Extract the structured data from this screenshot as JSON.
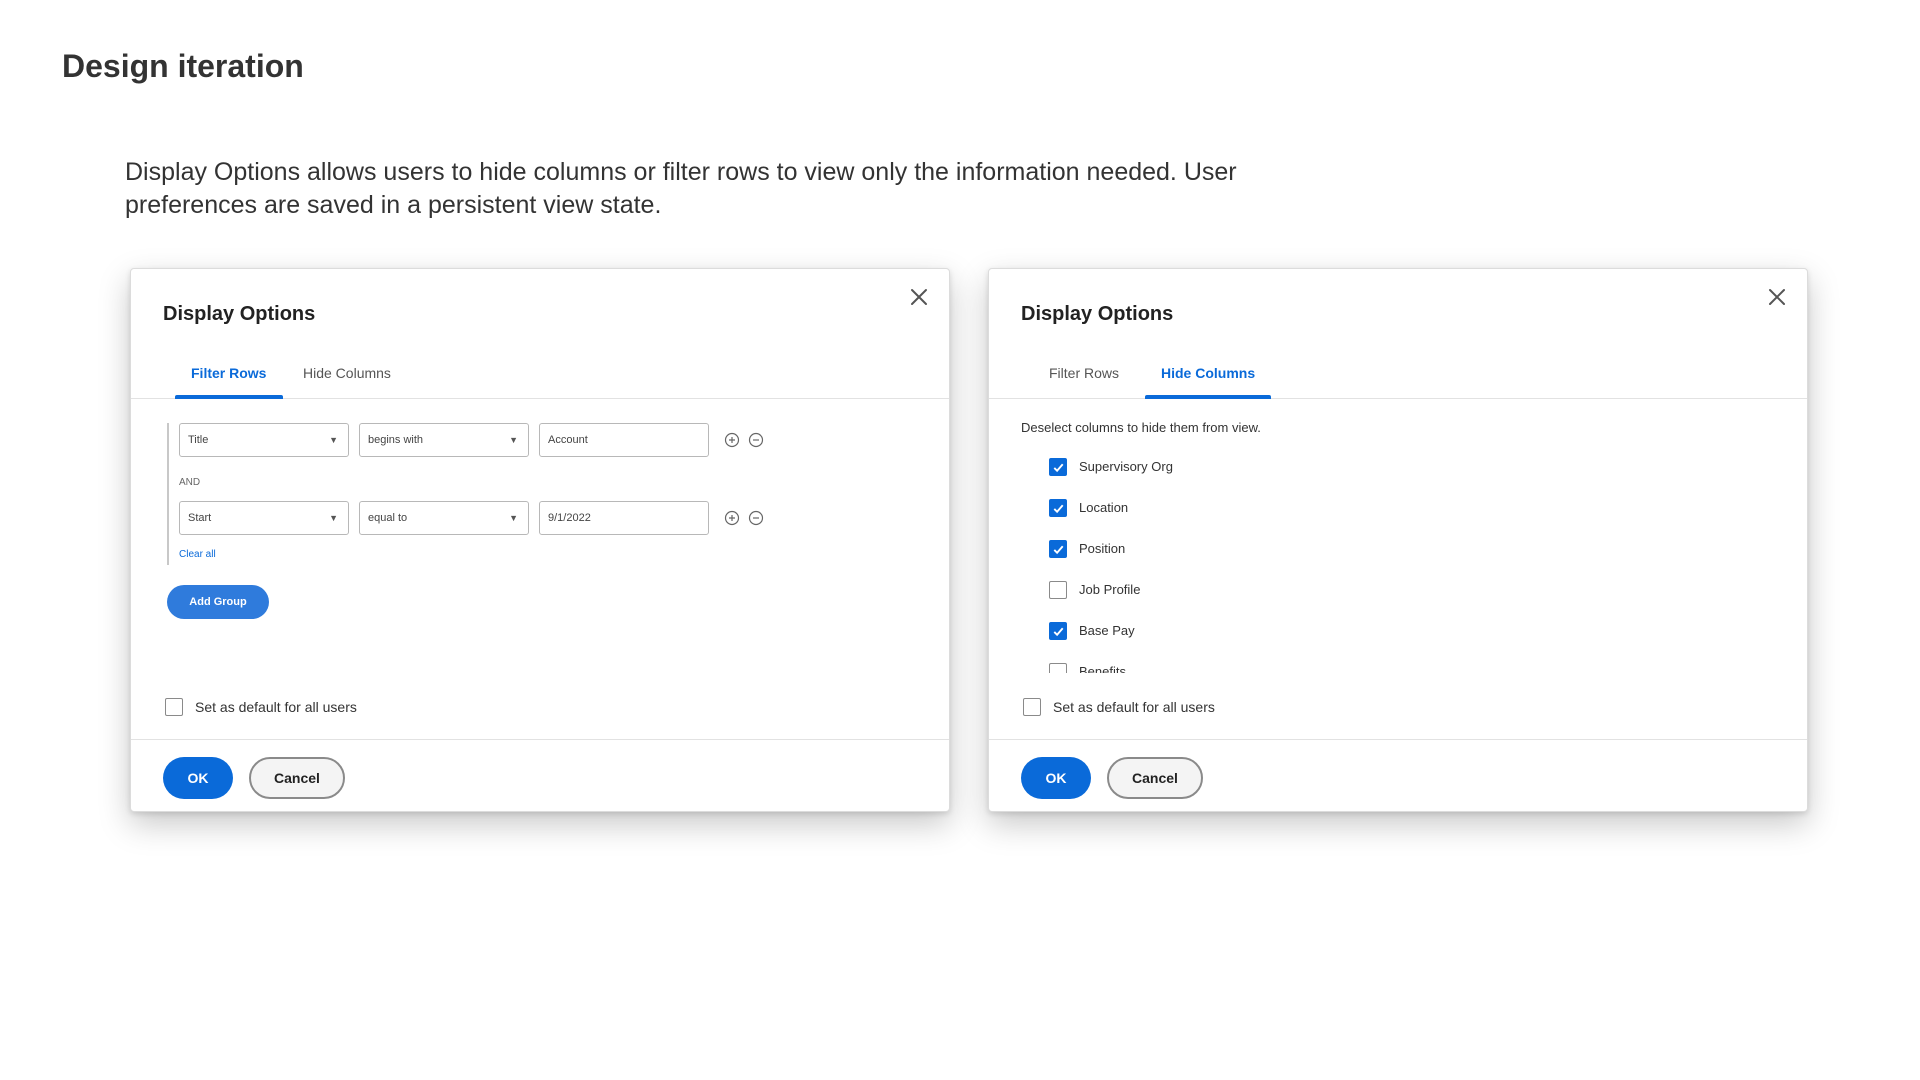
{
  "page": {
    "title": "Design iteration",
    "description": "Display Options allows users to hide columns or filter rows to view only the information needed. User preferences are saved in a persistent view state."
  },
  "colors": {
    "accent": "#0a6ad9",
    "add_group": "#2f7bdc",
    "text": "#333333"
  },
  "dialog_left": {
    "title": "Display Options",
    "tabs": [
      {
        "label": "Filter Rows",
        "active": true
      },
      {
        "label": "Hide Columns",
        "active": false
      }
    ],
    "filters": [
      {
        "field": "Title",
        "operator": "begins with",
        "value": "Account"
      },
      {
        "field": "Start",
        "operator": "equal to",
        "value": "9/1/2022"
      }
    ],
    "and_label": "AND",
    "clear_all": "Clear all",
    "add_group": "Add Group",
    "default_label": "Set as default for all users",
    "default_checked": false,
    "ok": "OK",
    "cancel": "Cancel"
  },
  "dialog_right": {
    "title": "Display Options",
    "tabs": [
      {
        "label": "Filter Rows",
        "active": false
      },
      {
        "label": "Hide Columns",
        "active": true
      }
    ],
    "hint": "Deselect columns to hide them from view.",
    "columns": [
      {
        "label": "Supervisory Org",
        "checked": true
      },
      {
        "label": "Location",
        "checked": true
      },
      {
        "label": "Position",
        "checked": true
      },
      {
        "label": "Job Profile",
        "checked": false
      },
      {
        "label": "Base Pay",
        "checked": true
      },
      {
        "label": "Benefits",
        "checked": false
      }
    ],
    "default_label": "Set as default for all users",
    "default_checked": false,
    "ok": "OK",
    "cancel": "Cancel"
  }
}
